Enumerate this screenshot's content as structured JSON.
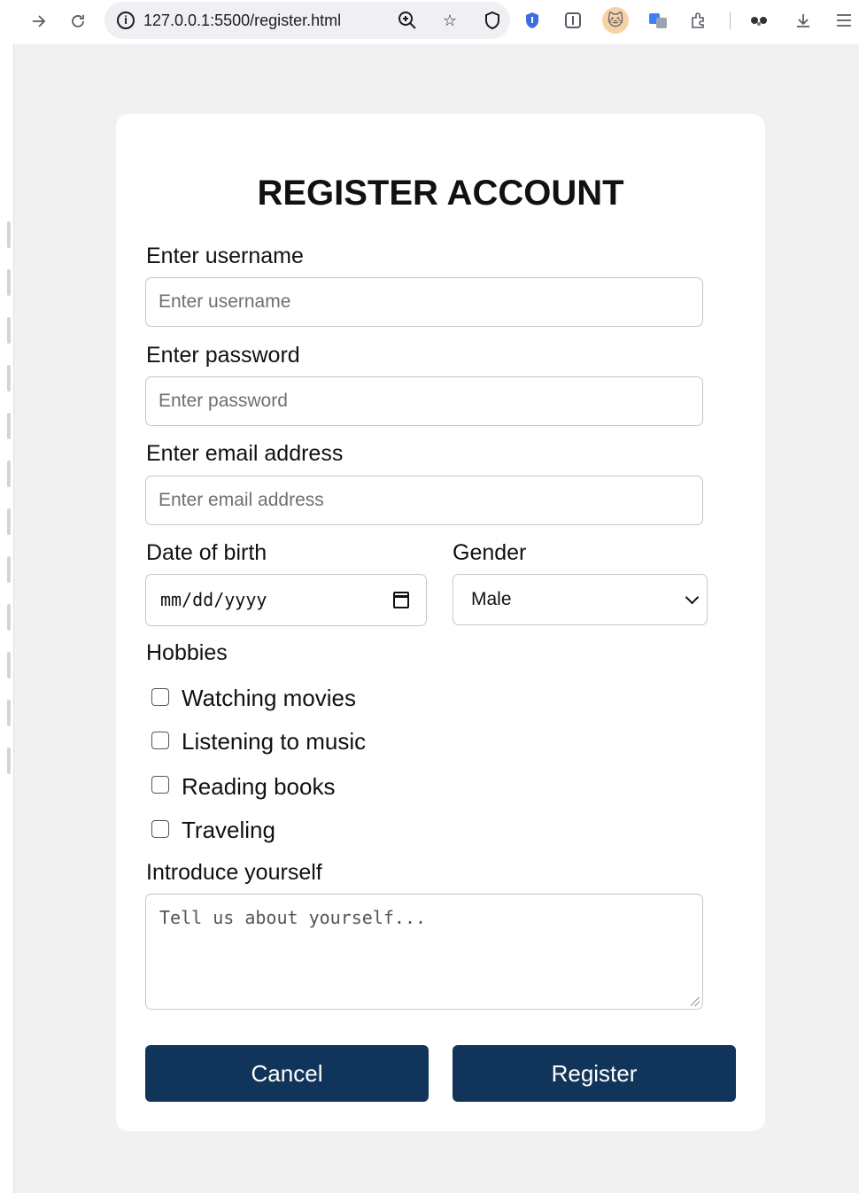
{
  "browser": {
    "url": "127.0.0.1:5500/register.html"
  },
  "form": {
    "title": "REGISTER ACCOUNT",
    "username": {
      "label": "Enter username",
      "placeholder": "Enter username"
    },
    "password": {
      "label": "Enter password",
      "placeholder": "Enter password"
    },
    "email": {
      "label": "Enter email address",
      "placeholder": "Enter email address"
    },
    "dob": {
      "label": "Date of birth",
      "placeholder": "mm/dd/yyyy"
    },
    "gender": {
      "label": "Gender",
      "selected": "Male"
    },
    "hobbies": {
      "label": "Hobbies",
      "options": [
        "Watching movies",
        "Listening to music",
        "Reading books",
        "Traveling"
      ]
    },
    "intro": {
      "label": "Introduce yourself",
      "placeholder": "Tell us about yourself..."
    },
    "cancel_label": "Cancel",
    "register_label": "Register"
  },
  "colors": {
    "button_bg": "#11355a",
    "page_bg": "#f1f1f1"
  },
  "icons": [
    "back-icon",
    "reload-icon",
    "info-icon",
    "zoom-icon",
    "bookmark-star-icon",
    "shield-icon",
    "extensions-icon",
    "download-icon",
    "menu-icon",
    "calendar-icon",
    "chevron-down-icon"
  ]
}
